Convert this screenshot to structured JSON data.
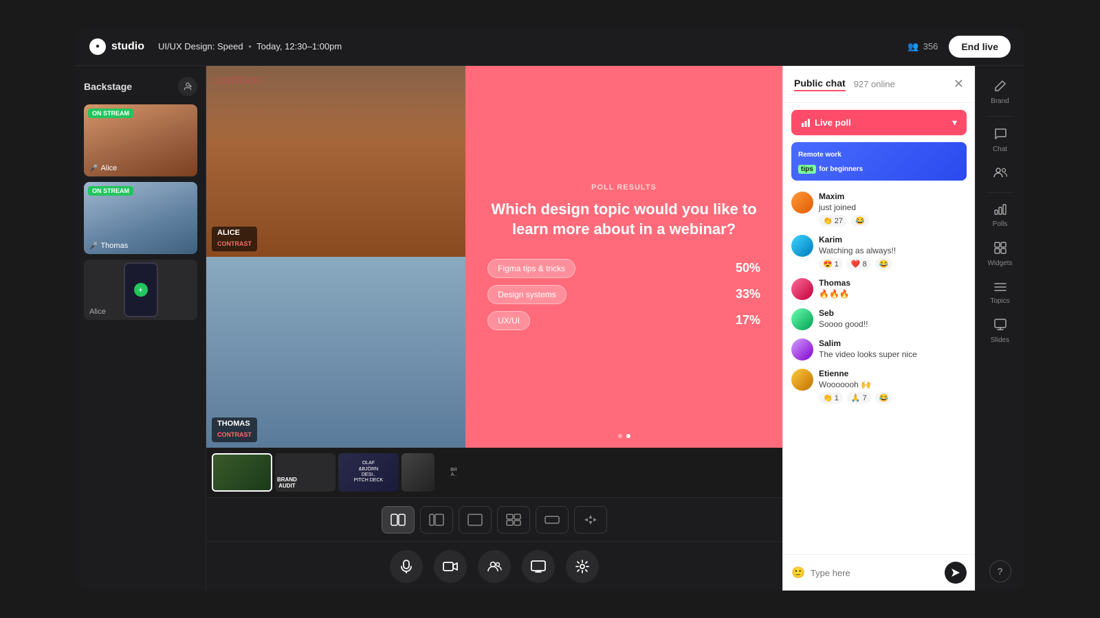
{
  "app": {
    "logo_text": "studio",
    "session_title": "UI/UX Design: Speed",
    "session_time": "Today, 12:30–1:00pm",
    "viewers_count": "356",
    "end_live_label": "End live"
  },
  "sidebar": {
    "title": "Backstage",
    "add_person_icon": "+👤",
    "speakers": [
      {
        "id": "alice",
        "name": "Alice",
        "on_stream": true,
        "badge": "On stream"
      },
      {
        "id": "thomas",
        "name": "Thomas",
        "on_stream": true,
        "badge": "On stream"
      },
      {
        "id": "screen",
        "name": "Alice",
        "on_stream": false,
        "badge": ""
      }
    ]
  },
  "stage": {
    "alice_label": "ALICE",
    "alice_sub": "CONTRAST",
    "alice_contrast": "contrast",
    "thomas_label": "THOMAS",
    "thomas_sub": "CONTRAST",
    "poll": {
      "label": "POLL RESULTS",
      "question": "Which design topic would you like to learn more about in a webinar?",
      "options": [
        {
          "text": "Figma tips & tricks",
          "pct": "50%"
        },
        {
          "text": "Design systems",
          "pct": "33%"
        },
        {
          "text": "UX/UI",
          "pct": "17%"
        }
      ]
    }
  },
  "layout_buttons": [
    {
      "id": "split",
      "icon": "⊞",
      "active": true
    },
    {
      "id": "side",
      "icon": "▣",
      "active": false
    },
    {
      "id": "single",
      "icon": "▢",
      "active": false
    },
    {
      "id": "grid",
      "icon": "⊟",
      "active": false
    },
    {
      "id": "full",
      "icon": "▭",
      "active": false
    },
    {
      "id": "auto",
      "icon": "✦",
      "active": false
    }
  ],
  "controls": [
    {
      "id": "mic",
      "icon": "🎤"
    },
    {
      "id": "camera",
      "icon": "📷"
    },
    {
      "id": "audience",
      "icon": "👥"
    },
    {
      "id": "screen",
      "icon": "🖥"
    },
    {
      "id": "settings",
      "icon": "⚙"
    }
  ],
  "chat": {
    "tab_label": "Public chat",
    "online_count": "927 online",
    "live_poll_label": "Live poll",
    "widget_text": "Remote work tips for beginners",
    "messages": [
      {
        "id": 1,
        "name": "Maxim",
        "text": "just joined",
        "reactions": [
          {
            "emoji": "👏",
            "count": "27"
          },
          {
            "emoji": "😂",
            "count": ""
          }
        ]
      },
      {
        "id": 2,
        "name": "Karim",
        "text": "Watching as always!!",
        "reactions": [
          {
            "emoji": "😍",
            "count": "1"
          },
          {
            "emoji": "❤️",
            "count": "8"
          },
          {
            "emoji": "😂",
            "count": ""
          }
        ]
      },
      {
        "id": 3,
        "name": "Thomas",
        "text": "🔥🔥🔥",
        "reactions": []
      },
      {
        "id": 4,
        "name": "Seb",
        "text": "Soooo good!!",
        "reactions": []
      },
      {
        "id": 5,
        "name": "Salim",
        "text": "The video looks super nice",
        "reactions": []
      },
      {
        "id": 6,
        "name": "Etienne",
        "text": "Wooooooh 🙌",
        "reactions": [
          {
            "emoji": "👏",
            "count": "1"
          },
          {
            "emoji": "🙏",
            "count": "7"
          },
          {
            "emoji": "😂",
            "count": ""
          }
        ]
      }
    ],
    "input_placeholder": "Type here",
    "send_icon": "➤"
  },
  "right_nav": [
    {
      "id": "edit",
      "icon": "✏️",
      "label": "Brand"
    },
    {
      "id": "chat-nav",
      "icon": "💬",
      "label": "Chat"
    },
    {
      "id": "audience-nav",
      "icon": "👥",
      "label": ""
    },
    {
      "id": "polls",
      "icon": "≡",
      "label": "Polls"
    },
    {
      "id": "widgets",
      "icon": "⊡",
      "label": "Widgets"
    },
    {
      "id": "topics",
      "icon": "☰",
      "label": "Topics"
    },
    {
      "id": "slides",
      "icon": "▣",
      "label": "Slides"
    }
  ]
}
